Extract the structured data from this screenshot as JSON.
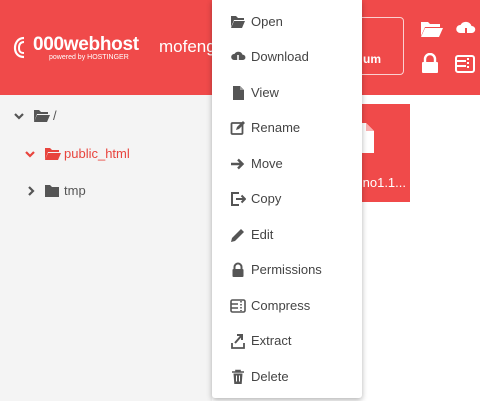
{
  "header": {
    "logo_main": "000webhost",
    "logo_sub": "powered by HOSTINGER",
    "site_name": "mofeng",
    "premium_label": "um",
    "icons": [
      "folder-open-icon",
      "cloud-upload-icon",
      "lock-icon",
      "archive-icon"
    ]
  },
  "tree": {
    "items": [
      {
        "label": "/",
        "expanded": true,
        "active": false
      },
      {
        "label": "public_html",
        "expanded": true,
        "active": true
      },
      {
        "label": "tmp",
        "expanded": false,
        "active": false
      }
    ]
  },
  "file_tile": {
    "name": "no1.1..."
  },
  "context_menu": {
    "items": [
      {
        "label": "Open",
        "icon": "folder-open-icon"
      },
      {
        "label": "Download",
        "icon": "cloud-download-icon"
      },
      {
        "label": "View",
        "icon": "file-icon"
      },
      {
        "label": "Rename",
        "icon": "edit-square-icon"
      },
      {
        "label": "Move",
        "icon": "arrow-right-icon"
      },
      {
        "label": "Copy",
        "icon": "copy-icon"
      },
      {
        "label": "Edit",
        "icon": "pencil-icon"
      },
      {
        "label": "Permissions",
        "icon": "lock-icon"
      },
      {
        "label": "Compress",
        "icon": "compress-icon"
      },
      {
        "label": "Extract",
        "icon": "extract-icon"
      },
      {
        "label": "Delete",
        "icon": "trash-icon"
      }
    ]
  },
  "colors": {
    "brand": "#f04a4a",
    "active_text": "#e8443d",
    "sidebar_bg": "#f4f4f4",
    "menu_text": "#444444",
    "icon_gray": "#555555"
  }
}
